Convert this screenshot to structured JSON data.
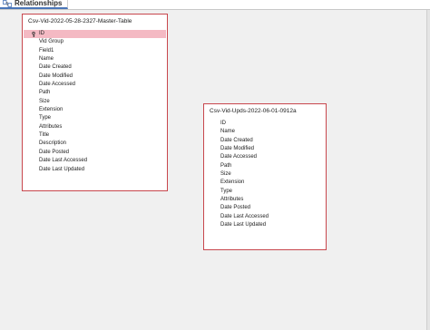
{
  "tab": {
    "label": "Relationships",
    "icon": "relationships-icon"
  },
  "tables": [
    {
      "title": "Csv-Vid-2022-05-28-2327-Master-Table",
      "fields": [
        {
          "label": "ID",
          "primary_key": true,
          "selected": true
        },
        {
          "label": "Vid Group"
        },
        {
          "label": "Field1"
        },
        {
          "label": "Name"
        },
        {
          "label": "Date Created"
        },
        {
          "label": "Date Modified"
        },
        {
          "label": "Date Accessed"
        },
        {
          "label": "Path"
        },
        {
          "label": "Size"
        },
        {
          "label": "Extension"
        },
        {
          "label": "Type"
        },
        {
          "label": "Attributes"
        },
        {
          "label": "Title"
        },
        {
          "label": "Description"
        },
        {
          "label": "Date Posted"
        },
        {
          "label": "Date Last Accessed"
        },
        {
          "label": "Date Last Updated"
        }
      ]
    },
    {
      "title": "Csv-Vid-Upds-2022-06-01-0912a",
      "fields": [
        {
          "label": "ID"
        },
        {
          "label": "Name"
        },
        {
          "label": "Date Created"
        },
        {
          "label": "Date Modified"
        },
        {
          "label": "Date Accessed"
        },
        {
          "label": "Path"
        },
        {
          "label": "Size"
        },
        {
          "label": "Extension"
        },
        {
          "label": "Type"
        },
        {
          "label": "Attributes"
        },
        {
          "label": "Date Posted"
        },
        {
          "label": "Date Last Accessed"
        },
        {
          "label": "Date Last Updated"
        }
      ]
    }
  ],
  "colors": {
    "table_border": "#c8474d",
    "selected_row": "#f4b9c3",
    "canvas": "#f0f0f0",
    "tab_accent": "#4a76b8"
  }
}
